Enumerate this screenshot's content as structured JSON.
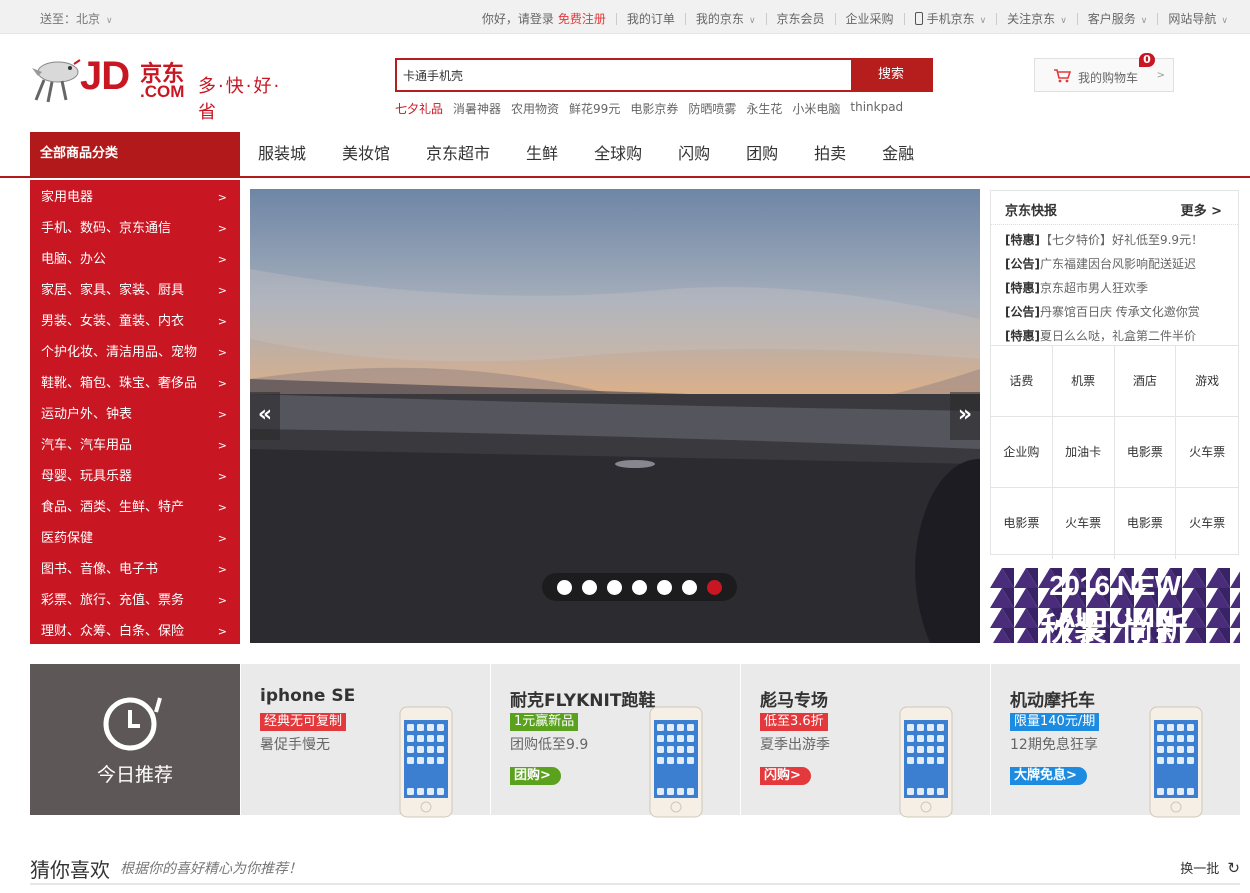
{
  "topbar": {
    "location": "送至：北京",
    "greeting": "你好，请登录",
    "register": "免费注册",
    "orders": "我的订单",
    "my_jd": "我的京东",
    "member": "京东会员",
    "enterprise": "企业采购",
    "mobile": "手机京东",
    "follow": "关注京东",
    "service": "客户服务",
    "sitenav": "网站导航"
  },
  "logo": {
    "jd": "JD",
    "cn": "京东",
    "dotcom": ".COM",
    "slogan": "多·快·好·省"
  },
  "search": {
    "value": "卡通手机壳",
    "button": "搜索",
    "hotwords": [
      "七夕礼品",
      "消暑神器",
      "农用物资",
      "鲜花99元",
      "电影京券",
      "防晒喷雾",
      "永生花",
      "小米电脑",
      "thinkpad"
    ]
  },
  "cart": {
    "label": "我的购物车",
    "count": "0",
    "arrow": ">"
  },
  "nav": {
    "all_categories": "全部商品分类",
    "items": [
      "服装城",
      "美妆馆",
      "京东超市",
      "生鲜",
      "全球购",
      "闪购",
      "团购",
      "拍卖",
      "金融"
    ]
  },
  "categories": [
    "家用电器",
    "手机、数码、京东通信",
    "电脑、办公",
    "家居、家具、家装、厨具",
    "男装、女装、童装、内衣",
    "个护化妆、清洁用品、宠物",
    "鞋靴、箱包、珠宝、奢侈品",
    "运动户外、钟表",
    "汽车、汽车用品",
    "母婴、玩具乐器",
    "食品、酒类、生鲜、特产",
    "医药保健",
    "图书、音像、电子书",
    "彩票、旅行、充值、票务",
    "理财、众筹、白条、保险"
  ],
  "category_arrow": ">",
  "banner": {
    "prev": "«",
    "next": "»",
    "slide_count": 7,
    "active_slide": 7
  },
  "news": {
    "title": "京东快报",
    "more": "更多 >",
    "items": [
      {
        "tag": "[特惠]",
        "text": "【七夕特价】好礼低至9.9元！"
      },
      {
        "tag": "[公告]",
        "text": "广东福建因台风影响配送延迟"
      },
      {
        "tag": "[特惠]",
        "text": "京东超市男人狂欢季"
      },
      {
        "tag": "[公告]",
        "text": "丹寨馆百日庆 传承文化邀你赏"
      },
      {
        "tag": "[特惠]",
        "text": "夏日么么哒，礼盒第二件半价"
      }
    ],
    "services": [
      "话费",
      "机票",
      "酒店",
      "游戏",
      "企业购",
      "加油卡",
      "电影票",
      "火车票",
      "电影票",
      "火车票",
      "电影票",
      "火车票"
    ]
  },
  "autumn": {
    "line1": "2016 NEW AUTUMN",
    "line2": "秋装 尚新"
  },
  "today": {
    "label": "今日推荐",
    "products": [
      {
        "name": "iphone SE",
        "tag": "经典无可复制",
        "tag_color": "#e4393c",
        "sub": "暑促手慢无",
        "btn": "",
        "btn_color": ""
      },
      {
        "name": "耐克FLYKNIT跑鞋",
        "tag": "1元赢新品",
        "tag_color": "#5aa11e",
        "sub": "团购低至9.9",
        "btn": "团购>",
        "btn_color": "#5aa11e"
      },
      {
        "name": "彪马专场",
        "tag": "低至3.6折",
        "tag_color": "#e4393c",
        "sub": "夏季出游季",
        "btn": "闪购>",
        "btn_color": "#e4393c"
      },
      {
        "name": "机动摩托车",
        "tag": "限量140元/期",
        "tag_color": "#1d8ce0",
        "sub": "12期免息狂享",
        "btn": "大牌免息>",
        "btn_color": "#1d8ce0"
      }
    ]
  },
  "guess": {
    "title": "猜你喜欢",
    "subtitle": "根据你的喜好精心为你推荐！",
    "change": "换一批"
  }
}
